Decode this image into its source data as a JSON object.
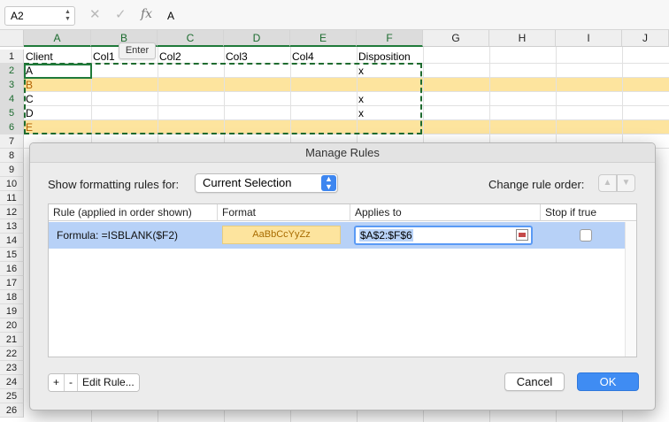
{
  "formula_bar": {
    "name_box": "A2",
    "cancel_glyph": "✕",
    "enter_glyph": "✓",
    "fx_label": "fx",
    "formula_value": "A"
  },
  "tooltip": "Enter",
  "columns": [
    "A",
    "B",
    "C",
    "D",
    "E",
    "F",
    "G",
    "H",
    "I",
    "J"
  ],
  "rows": [
    "1",
    "2",
    "3",
    "4",
    "5",
    "6",
    "7",
    "8",
    "9",
    "10",
    "11",
    "12",
    "13",
    "14",
    "15",
    "16",
    "17",
    "18",
    "19",
    "20",
    "21",
    "22",
    "23",
    "24",
    "25",
    "26"
  ],
  "cells": {
    "r1": [
      "Client",
      "Col1",
      "Col2",
      "Col3",
      "Col4",
      "Disposition"
    ],
    "a2": "A",
    "f2": "x",
    "a3": "B",
    "a4": "C",
    "f4": "x",
    "a5": "D",
    "f5": "x",
    "a6": "E"
  },
  "colors": {
    "highlight_fill": "#fde49e",
    "highlight_text": "#b15f00",
    "selection_green": "#1f7a3a",
    "dialog_selection": "#b7d1f7",
    "accent_blue": "#3f8cf3"
  },
  "dialog": {
    "title": "Manage Rules",
    "show_label": "Show formatting rules for:",
    "scope_value": "Current Selection",
    "order_label": "Change rule order:",
    "headers": {
      "rule": "Rule (applied in order shown)",
      "format": "Format",
      "applies": "Applies to",
      "stop": "Stop if true"
    },
    "rule": {
      "formula": "Formula: =ISBLANK($F2)",
      "preview": "AaBbCcYyZz",
      "applies_to": "$A$2:$F$6",
      "stop_if_true": false
    },
    "add_label": "+",
    "remove_label": "-",
    "edit_label": "Edit Rule...",
    "cancel_label": "Cancel",
    "ok_label": "OK"
  }
}
